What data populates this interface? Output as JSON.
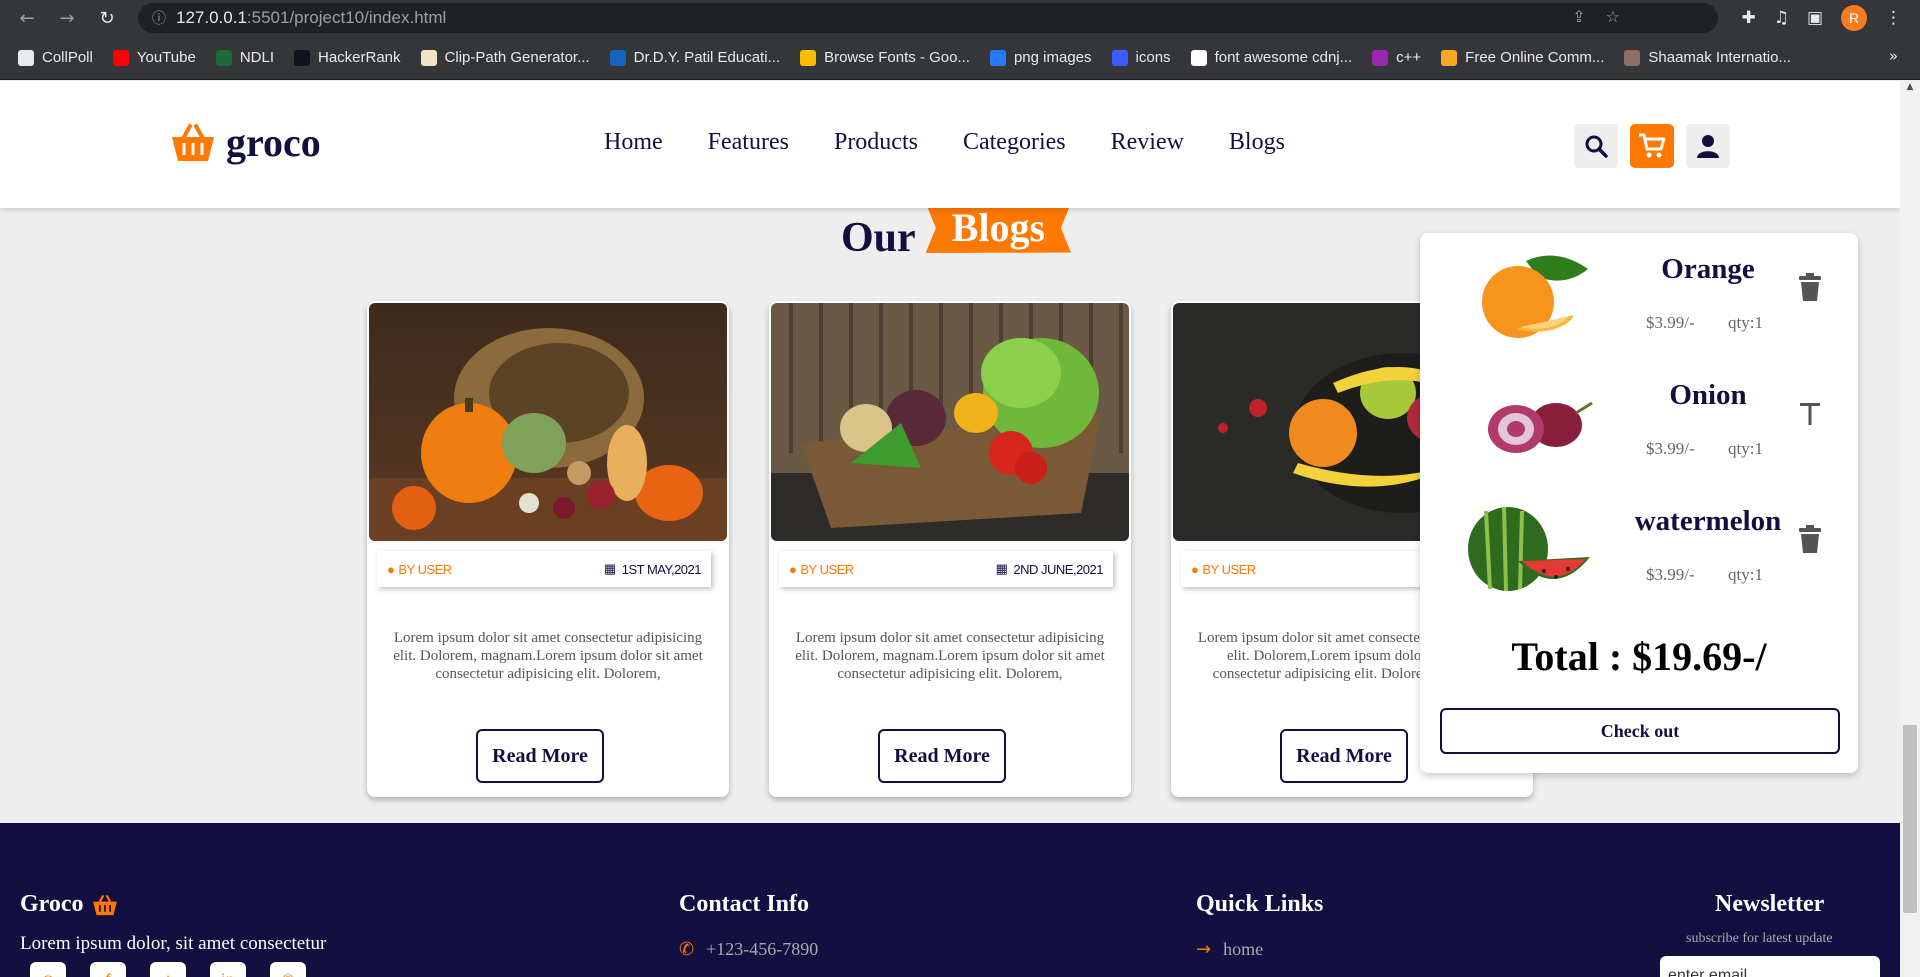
{
  "browser": {
    "url_host": "127.0.0.1",
    "url_path": ":5501/project10/index.html",
    "profile_initial": "R",
    "bookmarks": [
      {
        "label": "CollPoll",
        "color": "#e8eaed"
      },
      {
        "label": "YouTube",
        "color": "#ff0000"
      },
      {
        "label": "NDLI",
        "color": "#1e6b3a"
      },
      {
        "label": "HackerRank",
        "color": "#0e141e"
      },
      {
        "label": "Clip-Path Generator...",
        "color": "#f2e3c6"
      },
      {
        "label": "Dr.D.Y. Patil Educati...",
        "color": "#1565c0"
      },
      {
        "label": "Browse Fonts - Goo...",
        "color": "#fbbc04"
      },
      {
        "label": "png images",
        "color": "#2979ff"
      },
      {
        "label": "icons",
        "color": "#3d5afe"
      },
      {
        "label": "font awesome cdnj...",
        "color": "#ffffff"
      },
      {
        "label": "c++",
        "color": "#9c27b0"
      },
      {
        "label": "Free Online Comm...",
        "color": "#f9a825"
      },
      {
        "label": "Shaamak Internatio...",
        "color": "#8d6e63"
      }
    ]
  },
  "header": {
    "brand": "groco",
    "nav": [
      "Home",
      "Features",
      "Products",
      "Categories",
      "Review",
      "Blogs"
    ]
  },
  "blogs": {
    "title_main": "Our",
    "title_highlight": "Blogs",
    "cards": [
      {
        "author": "BY USER",
        "date": "1ST MAY,2021",
        "text": "Lorem ipsum dolor sit amet consectetur adipisicing elit. Dolorem, magnam.Lorem ipsum dolor sit amet consectetur adipisicing elit. Dolorem,",
        "button": "Read More"
      },
      {
        "author": "BY USER",
        "date": "2ND JUNE,2021",
        "text": "Lorem ipsum dolor sit amet consectetur adipisicing elit. Dolorem, magnam.Lorem ipsum dolor sit amet consectetur adipisicing elit. Dolorem,",
        "button": "Read More"
      },
      {
        "author": "BY USER",
        "date": "",
        "text": "Lorem ipsum dolor sit amet consectetur adipisicing elit. Dolorem,Lorem ipsum dolor sit amet consectetur adipisicing elit. Dolorem,Dolorem",
        "button": "Read More"
      }
    ]
  },
  "cart": {
    "items": [
      {
        "name": "Orange",
        "price": "$3.99/-",
        "qty": "qty:1"
      },
      {
        "name": "Onion",
        "price": "$3.99/-",
        "qty": "qty:1"
      },
      {
        "name": "watermelon",
        "price": "$3.99/-",
        "qty": "qty:1"
      }
    ],
    "total": "Total : $19.69-/",
    "checkout": "Check out"
  },
  "footer": {
    "brand": "Groco",
    "text": "Lorem ipsum dolor, sit amet consectetur",
    "contact_title": "Contact Info",
    "phone": "+123-456-7890",
    "links_title": "Quick Links",
    "link_home": "home",
    "newsletter_title": "Newsletter",
    "newsletter_sub": "subscribe for latest update",
    "email_placeholder": "enter email"
  },
  "colors": {
    "accent": "#ff7800",
    "navy": "#130f40"
  }
}
